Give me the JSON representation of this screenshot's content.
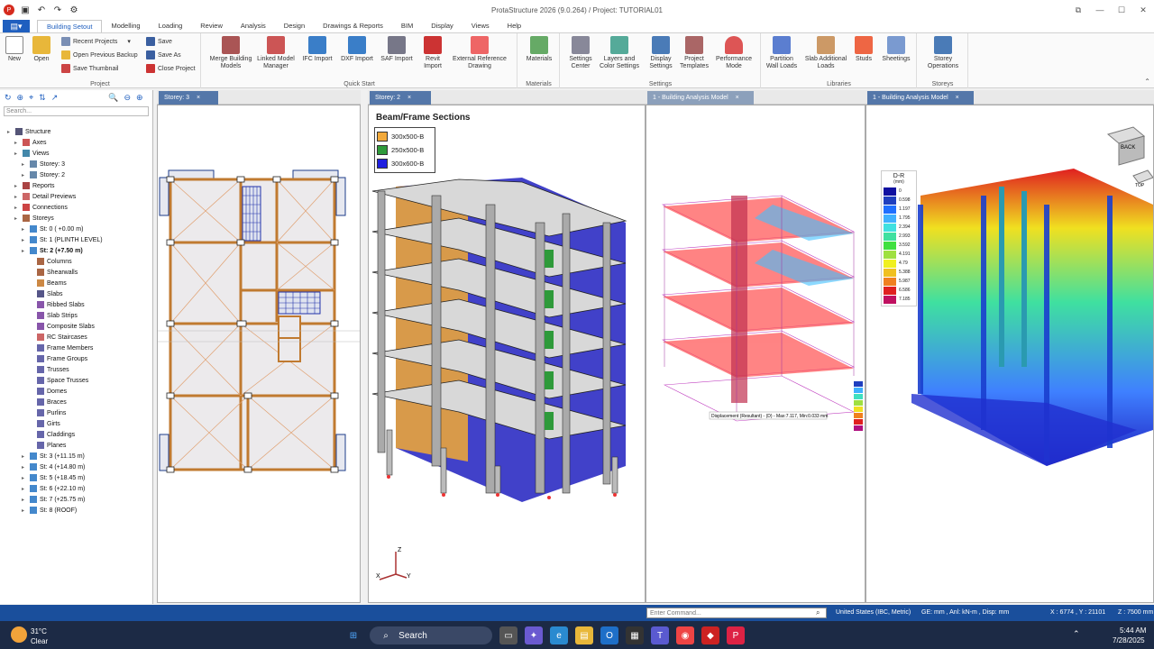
{
  "window": {
    "title": "ProtaStructure 2026 (9.0.264) / Project: TUTORIAL01"
  },
  "menu": {
    "file": "File",
    "tabs": [
      "Building Setout",
      "Modelling",
      "Loading",
      "Review",
      "Analysis",
      "Design",
      "Drawings & Reports",
      "BIM",
      "Display",
      "Views",
      "Help"
    ]
  },
  "ribbon": {
    "project": {
      "label": "Project",
      "new": "New",
      "open": "Open",
      "recent": "Recent Projects",
      "backup": "Open Previous Backup",
      "thumb": "Save Thumbnail",
      "save": "Save",
      "saveas": "Save As",
      "close": "Close Project"
    },
    "quickstart": {
      "label": "Quick Start",
      "merge": "Merge Building Models",
      "linked": "Linked Model Manager",
      "ifc": "IFC Import",
      "dxf": "DXF Import",
      "saf": "SAF Import",
      "revit": "Revit Import",
      "ext": "External Reference Drawing"
    },
    "materials": {
      "label": "Materials",
      "btn": "Materials"
    },
    "settings": {
      "label": "Settings",
      "center": "Settings Center",
      "layers": "Layers and Color Settings",
      "display": "Display Settings",
      "templates": "Project Templates",
      "perf": "Performance Mode"
    },
    "libraries": {
      "label": "Libraries",
      "partition": "Partition Wall Loads",
      "slab": "Slab Additional Loads",
      "studs": "Studs",
      "sheet": "Sheetings"
    },
    "storeys": {
      "label": "Storeys",
      "ops": "Storey Operations"
    }
  },
  "tree": {
    "search_placeholder": "Search...",
    "items": [
      "Structure",
      "Axes",
      "Views",
      "Storey: 3",
      "Storey: 2",
      "Reports",
      "Detail Previews",
      "Connections",
      "Storeys",
      "St: 0 ( +0.00 m)",
      "St: 1 (PLINTH LEVEL)",
      "St: 2 (+7.50 m)",
      "Columns",
      "Shearwalls",
      "Beams",
      "Slabs",
      "Ribbed Slabs",
      "Slab Strips",
      "Composite Slabs",
      "RC Staircases",
      "Frame Members",
      "Frame Groups",
      "Trusses",
      "Space Trusses",
      "Domes",
      "Braces",
      "Purlins",
      "Girts",
      "Claddings",
      "Planes",
      "St: 3 (+11.15 m)",
      "St: 4 (+14.80 m)",
      "St: 5 (+18.45 m)",
      "St: 6 (+22.10 m)",
      "St: 7 (+25.75 m)",
      "St: 8 (ROOF)"
    ]
  },
  "views": {
    "v1": "Storey: 3",
    "v2": "Storey: 2",
    "v3": "1 - Building Analysis Model",
    "v4": "1 - Building Analysis Model",
    "sections_title": "Beam/Frame Sections",
    "sections": [
      {
        "name": "300x500-B",
        "color": "#f2a93b"
      },
      {
        "name": "250x500-B",
        "color": "#2e9a3a"
      },
      {
        "name": "300x600-B",
        "color": "#2020e0"
      }
    ],
    "disp_caption": "Displacement (Resultant) - (D) -  Max:7.117, Min:0.033 mm",
    "legend_title": "D-R",
    "legend_unit": "(mm)",
    "legend_values": [
      "0",
      "0.598",
      "1.197",
      "1.795",
      "2.394",
      "2.993",
      "3.592",
      "4.191",
      "4.79",
      "5.388",
      "5.987",
      "6.586",
      "7.185"
    ],
    "cube_back": "BACK",
    "cube_top": "TOP",
    "axis_z": "Z",
    "axis_x": "X",
    "axis_y": "Y"
  },
  "status": {
    "cmd_placeholder": "Enter Command...",
    "region": "United States (IBC, Metric)",
    "units": "GE: mm , Anl: kN-m , Disp: mm",
    "xy": "X : 6774 , Y : 21101",
    "z": "Z : 7500 mm"
  },
  "taskbar": {
    "temp": "31°C",
    "weather": "Clear",
    "search": "Search",
    "time": "5:44 AM",
    "date": "7/28/2025"
  }
}
